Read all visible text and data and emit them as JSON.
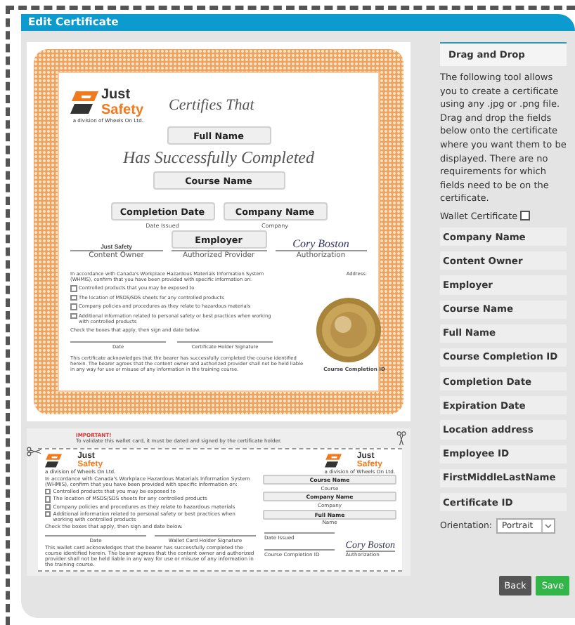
{
  "window": {
    "title": "Edit Certificate"
  },
  "certificate": {
    "logo": {
      "word_top": "Just",
      "word_bottom": "Safety",
      "tagline": "a division of Wheels On Ltd."
    },
    "certifies": "Certifies That",
    "full_name": "Full Name",
    "completed": "Has Successfully Completed",
    "course_name": "Course Name",
    "date_field": "Completion Date",
    "date_caption": "Date Issued",
    "company_field": "Company Name",
    "company_caption": "Company",
    "employer_field": "Employer",
    "signatures": [
      {
        "kind": "text",
        "value": "Just Safety",
        "caption": "Content Owner"
      },
      {
        "kind": "field",
        "caption": "Authorized Provider"
      },
      {
        "kind": "script",
        "value": "Cory Boston",
        "caption": "Authorization"
      }
    ],
    "intro": "In accordance with Canada's Workplace Hazardous Materials Information System (WHMIS), confirm that you have been provided with specific information on:",
    "address_label": "Address:",
    "checklist": [
      {
        "label": "Controlled products that you may be exposed to",
        "checked": false
      },
      {
        "label": "The location of MSDS/SDS sheets for any controlled products",
        "checked": false
      },
      {
        "label": "Company policies and procedures as they relate to hazardous materials",
        "checked": false
      },
      {
        "label": "Additional information related to personal safety or best practices when working with controlled products",
        "checked": false
      }
    ],
    "instruction": "Check the boxes that apply, then sign and date below.",
    "sign_lines": [
      "Date",
      "Certificate Holder Signature"
    ],
    "disclaimer": "This certificate acknowledges that the bearer has successfully completed the course identified herein. The bearer agrees that the content owner and authorized provider shall not be held liable in any way for use or misuse of any information in the training course.",
    "completion_id_label": "Course Completion ID"
  },
  "wallet_card": {
    "notice_title": "IMPORTANT!",
    "notice": "To validate this wallet card, it must be dated and signed by the certificate holder.",
    "logos": [
      {
        "word_top": "Just",
        "word_bottom": "Safety",
        "tagline": "a division of Wheels On Ltd."
      },
      {
        "word_top": "Just",
        "word_bottom": "Safety",
        "tagline": "a division of Wheels On Ltd."
      }
    ],
    "intro": "In accordance with Canada's Workplace Hazardous Materials Information System (WHMIS), confirm that you have been provided with specific information on:",
    "checklist": [
      {
        "label": "Controlled products that you may be exposed to",
        "checked": false
      },
      {
        "label": "The location of MSDS/SDS sheets for any controlled products",
        "checked": false
      },
      {
        "label": "Company policies and procedures as they relate to hazardous materials",
        "checked": false
      },
      {
        "label": "Additional information related to personal safety or best practices when working with controlled products",
        "checked": false
      }
    ],
    "instruction": "Check the boxes that apply, then sign and date below.",
    "sign_lines": [
      "Date",
      "Wallet Card Holder Signature"
    ],
    "disclaimer": "This wallet card acknowledges that the bearer has successfully completed the course identified herein. The bearer agrees that the content owner and authorized provider shall not be held liable in any way for use or misuse of any information in the training course.",
    "fields": [
      {
        "value": "Course Name",
        "caption": "Course"
      },
      {
        "value": "Company Name",
        "caption": "Company"
      },
      {
        "value": "Full Name",
        "caption": "Name"
      }
    ],
    "date_label": "Date Issued",
    "completion_id_label": "Course Completion ID",
    "signature": "Cory Boston",
    "signature_caption": "Authorization"
  },
  "sidebar": {
    "title": "Drag and Drop",
    "description": "The following tool allows you to create a certificate using any .jpg or .png file. Drag and drop the fields below onto the certificate where you want them to be displayed. There are no requirements for which fields need to be on the certificate.",
    "wallet_checkbox": {
      "label": "Wallet Certificate",
      "checked": false
    },
    "fields": [
      "Company Name",
      "Content Owner",
      "Employer",
      "Course Name",
      "Full Name",
      "Course Completion ID",
      "Completion Date",
      "Expiration Date",
      "Location address",
      "Employee ID",
      "FirstMiddleLastName",
      "Certificate ID"
    ],
    "orientation": {
      "label": "Orientation:",
      "value": "Portrait"
    }
  },
  "buttons": [
    {
      "label": "Back",
      "kind": "secondary"
    },
    {
      "label": "Save",
      "kind": "primary"
    }
  ]
}
